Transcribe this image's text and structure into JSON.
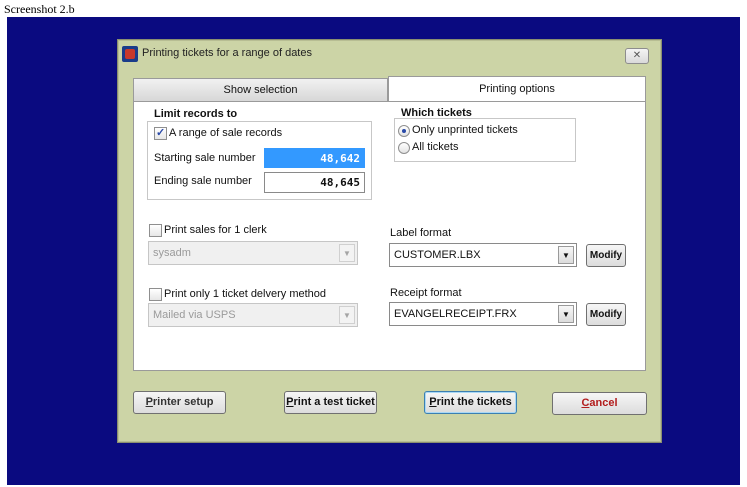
{
  "caption": "Screenshot 2.b",
  "window": {
    "title": "Printing tickets for a range of dates",
    "close_label": "✕"
  },
  "tabs": [
    {
      "label": "Show selection"
    },
    {
      "label": "Printing options"
    }
  ],
  "limit_records": {
    "heading": "Limit records to",
    "range_checkbox_label": "A range of sale records",
    "range_checked": true,
    "starting_label": "Starting sale number",
    "starting_value": "48,642",
    "ending_label": "Ending sale number",
    "ending_value": "48,645"
  },
  "which_tickets": {
    "heading": "Which tickets",
    "options": [
      "Only unprinted tickets",
      "All tickets"
    ],
    "selected": "Only unprinted tickets"
  },
  "clerk": {
    "checkbox_label": "Print sales for 1 clerk",
    "checked": false,
    "value": "sysadm"
  },
  "delivery": {
    "checkbox_label": "Print only 1 ticket delvery method",
    "checked": false,
    "value": "Mailed via USPS"
  },
  "label_format": {
    "label": "Label format",
    "value": "CUSTOMER.LBX",
    "modify_label": "Modify"
  },
  "receipt_format": {
    "label": "Receipt format",
    "value": "EVANGELRECEIPT.FRX",
    "modify_label": "Modify"
  },
  "buttons": {
    "printer_setup_first": "P",
    "printer_setup_rest": "rinter setup",
    "test_ticket_first": "P",
    "test_ticket_rest": "rint a test ticket",
    "print_tickets_first": "P",
    "print_tickets_rest": "rint the tickets",
    "cancel_first": "C",
    "cancel_rest": "ancel"
  },
  "colors": {
    "desktop": "#0a0a80",
    "window_frame": "#ccd4a6",
    "selection": "#3399ff",
    "cancel_text": "#b21c1c"
  }
}
